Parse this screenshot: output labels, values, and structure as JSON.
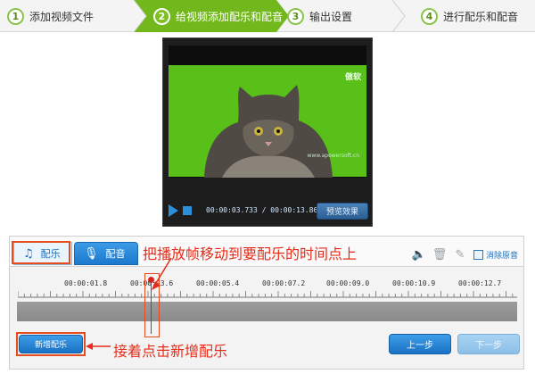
{
  "steps": [
    {
      "num": "1",
      "label": "添加视频文件",
      "active": false
    },
    {
      "num": "2",
      "label": "给视频添加配乐和配音",
      "active": true
    },
    {
      "num": "3",
      "label": "输出设置",
      "active": false
    },
    {
      "num": "4",
      "label": "进行配乐和配音",
      "active": false
    }
  ],
  "player": {
    "watermark": "傲软",
    "watermark_small": "www.apowersoft.cn",
    "time_current": "00:00:03.733",
    "time_separator": " / ",
    "time_total": "00:00:13.866",
    "preview_label": "预览效果",
    "play_icon": "play-icon",
    "stop_icon": "stop-icon"
  },
  "tabs": {
    "music_label": "配乐",
    "music_icon": "♫",
    "voice_label": "配音",
    "voice_icon": "🎙"
  },
  "annotations": {
    "top": "把播放帧移动到要配乐的时间点上",
    "bottom": "接着点击新增配乐"
  },
  "tools": {
    "volume_icon": "🔈",
    "delete_icon": "🗑",
    "clean_icon": "✎",
    "remove_audio_label": "消除原音",
    "remove_audio_checked": false
  },
  "timeline": {
    "labels": [
      "00:00:01.8",
      "00:00:03.6",
      "00:00:05.4",
      "00:00:07.2",
      "00:00:09.0",
      "00:00:10.9",
      "00:00:12.7"
    ],
    "playhead_time": "00:00:03.733"
  },
  "buttons": {
    "add_music": "新增配乐",
    "prev": "上一步",
    "next": "下一步"
  },
  "colors": {
    "accent": "#1a72c4",
    "step_active": "#7cc11e",
    "annotation": "#e62c1a",
    "green_screen": "#58c019"
  }
}
